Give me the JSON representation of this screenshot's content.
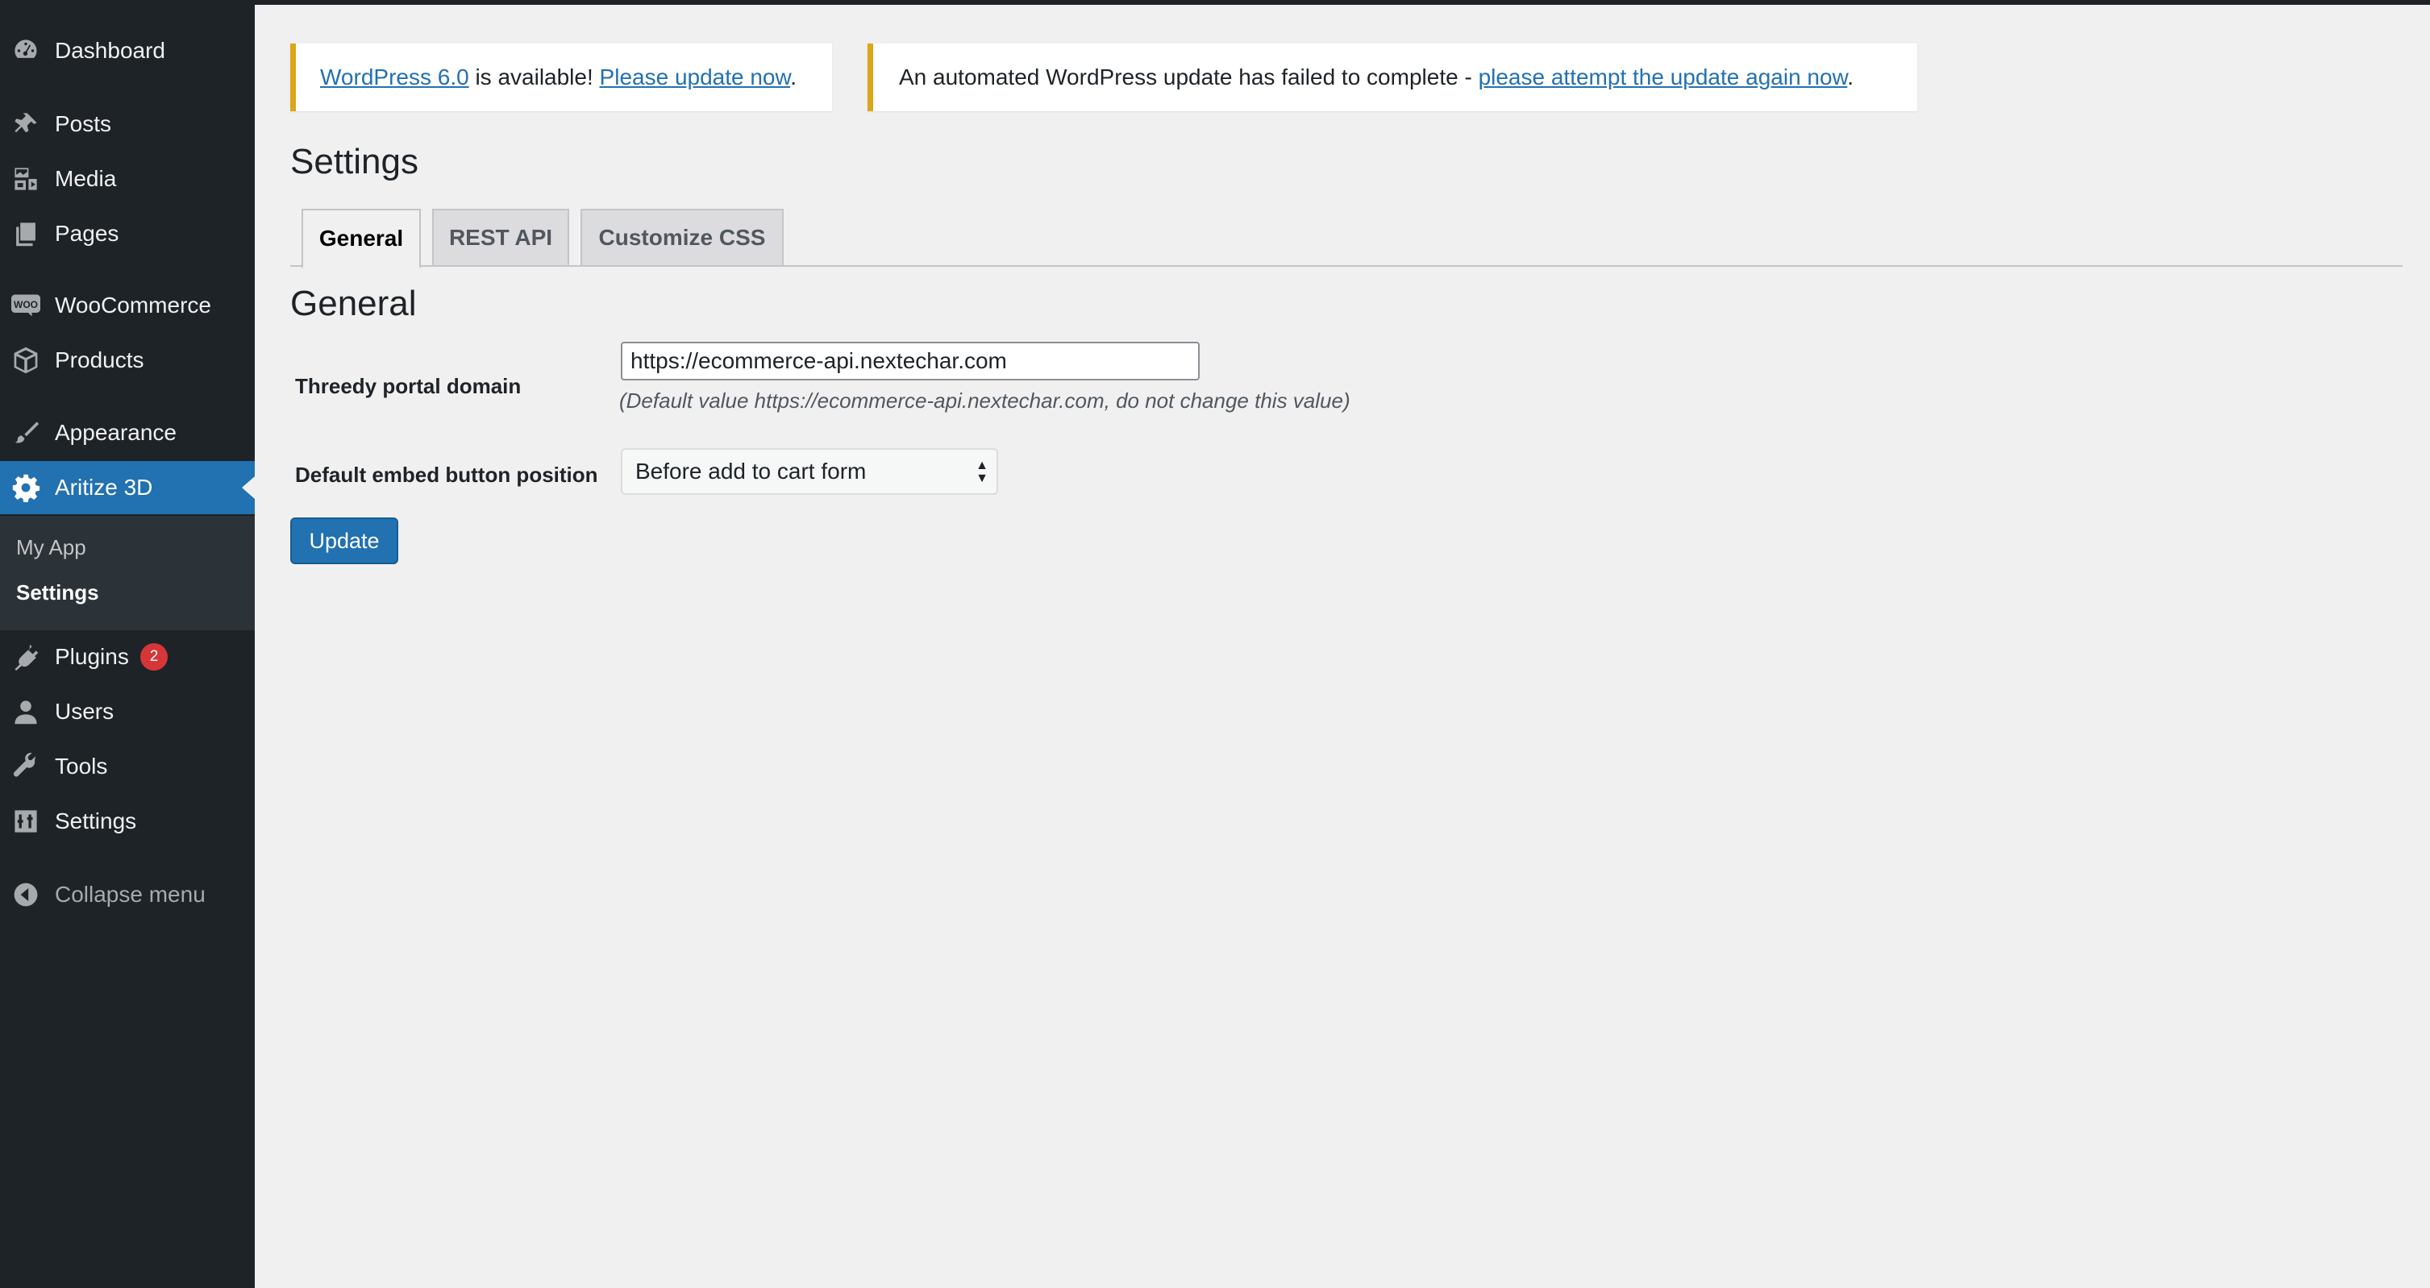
{
  "sidebar": {
    "items": [
      {
        "label": "Dashboard",
        "icon": "dashboard-icon"
      },
      {
        "label": "Posts",
        "icon": "pushpin-icon"
      },
      {
        "label": "Media",
        "icon": "media-icon"
      },
      {
        "label": "Pages",
        "icon": "pages-icon"
      },
      {
        "label": "WooCommerce",
        "icon": "woocommerce-icon"
      },
      {
        "label": "Products",
        "icon": "box-icon"
      },
      {
        "label": "Appearance",
        "icon": "paintbrush-icon"
      },
      {
        "label": "Aritize 3D",
        "icon": "gear-icon"
      },
      {
        "label": "Plugins",
        "icon": "plug-icon"
      },
      {
        "label": "Users",
        "icon": "user-icon"
      },
      {
        "label": "Tools",
        "icon": "wrench-icon"
      },
      {
        "label": "Settings",
        "icon": "sliders-icon"
      },
      {
        "label": "Collapse menu",
        "icon": "collapse-icon"
      }
    ],
    "submenu": [
      {
        "label": "My App"
      },
      {
        "label": "Settings"
      }
    ],
    "plugins_badge": "2",
    "accent_color": "#2271b1"
  },
  "notices": {
    "update": {
      "link1": "WordPress 6.0",
      "text": " is available! ",
      "link2": "Please update now",
      "end": "."
    },
    "failed": {
      "text": "An automated WordPress update has failed to complete - ",
      "link": "please attempt the update again now",
      "end": "."
    }
  },
  "page": {
    "title": "Settings"
  },
  "tabs": [
    {
      "label": "General",
      "active": true
    },
    {
      "label": "REST API",
      "active": false
    },
    {
      "label": "Customize CSS",
      "active": false
    }
  ],
  "section": {
    "title": "General"
  },
  "form": {
    "portal_domain": {
      "label": "Threedy portal domain",
      "value": "https://ecommerce-api.nextechar.com",
      "description": "(Default value https://ecommerce-api.nextechar.com, do not change this value)"
    },
    "embed_position": {
      "label": "Default embed button position",
      "selected": "Before add to cart form"
    },
    "submit_label": "Update"
  }
}
